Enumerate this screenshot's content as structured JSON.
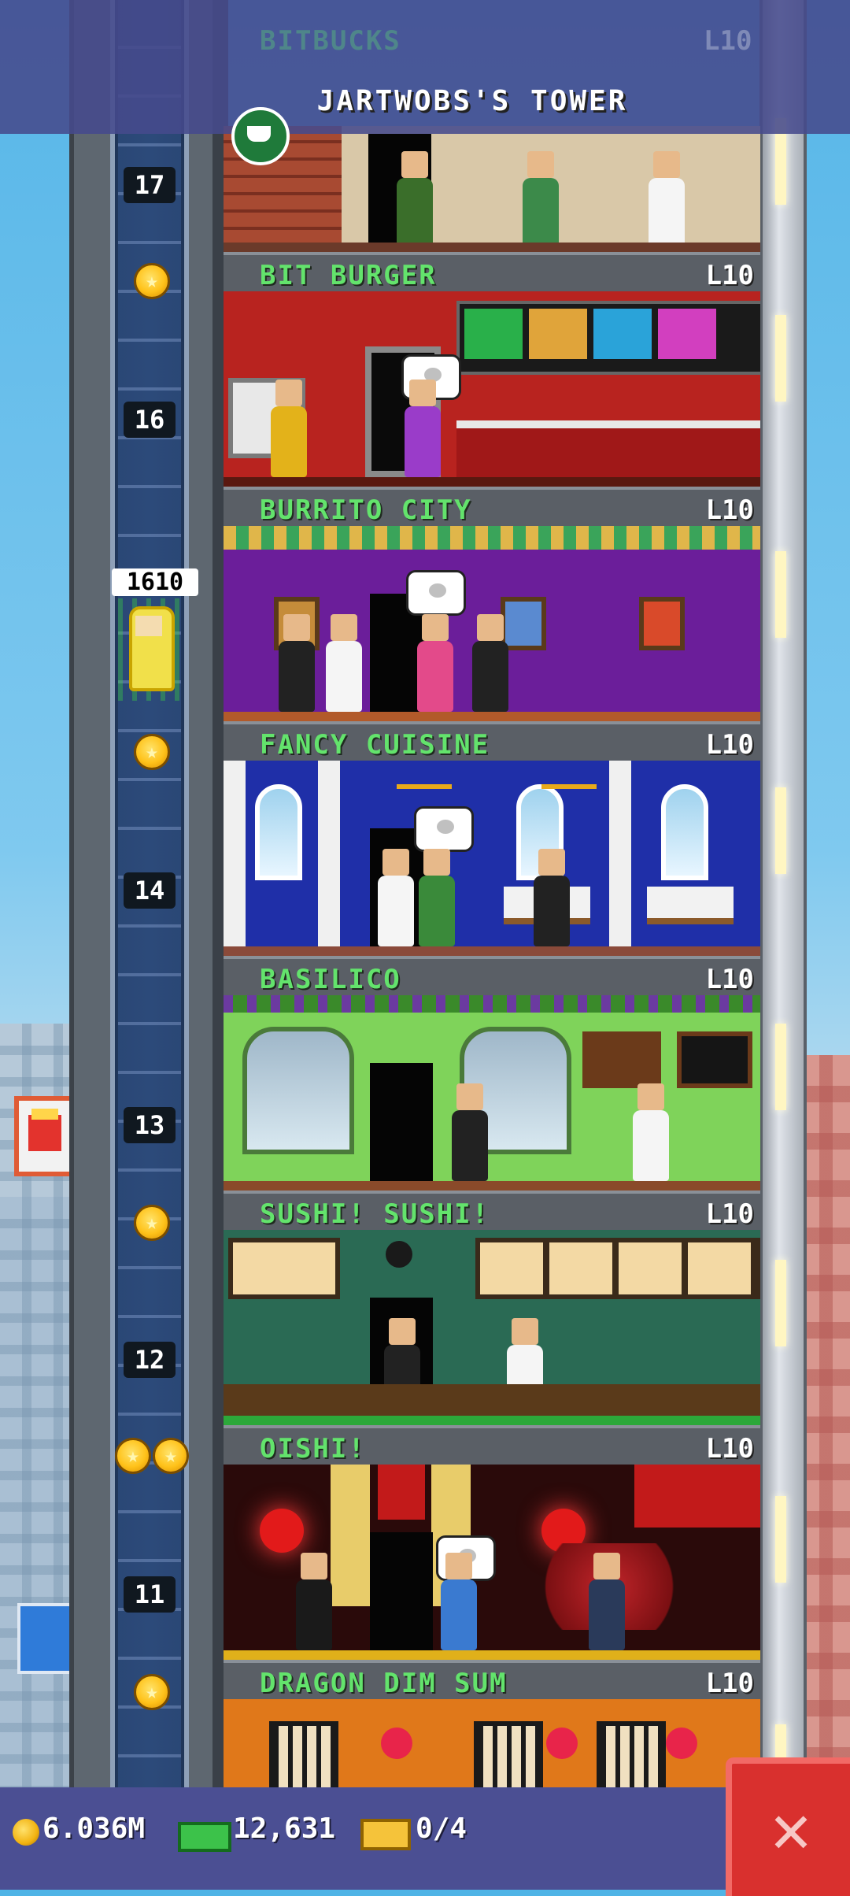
{
  "header": {
    "previous_floor_name": "BITBUCKS",
    "previous_floor_level": "L10",
    "tower_title": "JARTWOBS'S TOWER"
  },
  "floors": [
    {
      "name": "BIT BURGER",
      "level": "L10",
      "theme": "burger"
    },
    {
      "name": "BURRITO CITY",
      "level": "L10",
      "theme": "burrito"
    },
    {
      "name": "FANCY CUISINE",
      "level": "L10",
      "theme": "fancy"
    },
    {
      "name": "BASILICO",
      "level": "L10",
      "theme": "basilico"
    },
    {
      "name": "SUSHI! SUSHI!",
      "level": "L10",
      "theme": "sushi"
    },
    {
      "name": "OISHI!",
      "level": "L10",
      "theme": "oishi"
    },
    {
      "name": "DRAGON DIM SUM",
      "level": "L10",
      "theme": "dimsum"
    }
  ],
  "elevator": {
    "floor_numbers": [
      "17",
      "16",
      "14",
      "13",
      "12",
      "11"
    ],
    "passenger_count": "1610"
  },
  "bottom_bar": {
    "coins": "6.036M",
    "bux": "12,631",
    "tickets": "0/4"
  },
  "icons": {
    "coin": "coin-icon",
    "bux": "bux-icon",
    "ticket": "ticket-icon",
    "close": "close-icon",
    "star": "star-icon",
    "coffee": "coffee-cup-icon"
  },
  "colors": {
    "floor_name": "#63e36c",
    "header_bg": "#464a8c",
    "close_button": "#d9302e"
  }
}
